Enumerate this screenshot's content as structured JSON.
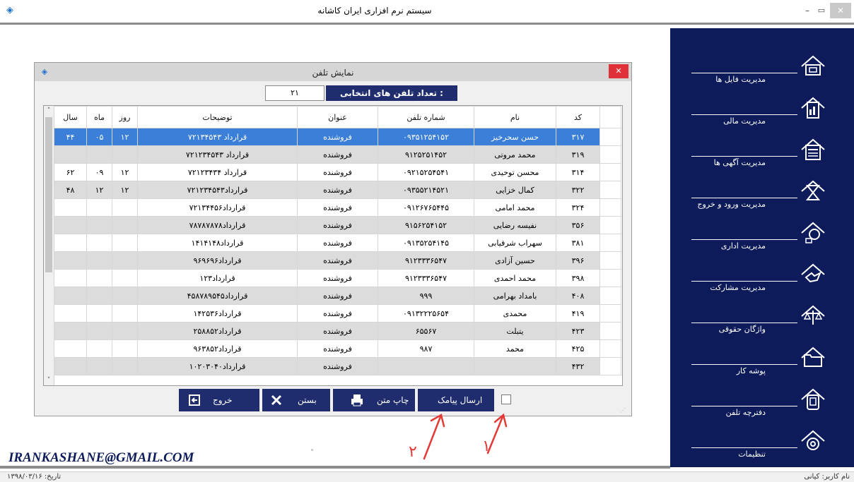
{
  "window": {
    "title": "سیستم نرم افزاری ایران کاشانه",
    "minimize": "–",
    "maximize": "▭",
    "close": "✕",
    "app_icon": "◈"
  },
  "sidebar": {
    "items": [
      {
        "label": "مدیریت فایل ها",
        "icon": "folder-icon"
      },
      {
        "label": "مدیریت مالی",
        "icon": "finance-document-icon"
      },
      {
        "label": "مدیریت آگهی ها",
        "icon": "news-icon"
      },
      {
        "label": "مدیریت ورود و خروج",
        "icon": "hourglass-icon"
      },
      {
        "label": "مدیریت اداری",
        "icon": "office-icon"
      },
      {
        "label": "مدیریت مشارکت",
        "icon": "handshake-icon"
      },
      {
        "label": "واژگان حقوقی",
        "icon": "scales-icon"
      },
      {
        "label": "پوشه کار",
        "icon": "open-folder-icon"
      },
      {
        "label": "دفترچه تلفن",
        "icon": "phone-icon"
      },
      {
        "label": "تنظیمات",
        "icon": "gear-icon"
      }
    ]
  },
  "dialog": {
    "title": "نمایش تلفن",
    "close": "✕",
    "count_label": "تعداد تلفن های انتخابی :",
    "count_value": "۲۱",
    "columns": [
      "سال",
      "ماه",
      "روز",
      "توضیحات",
      "عنوان",
      "شماره تلفن",
      "نام",
      "کد"
    ],
    "rows": [
      [
        "۴۴",
        "۰۵",
        "۱۲",
        "قرارداد ۷۲۱۳۴۵۴۳",
        "فروشنده",
        "۰۹۳۵۱۲۵۴۱۵۲",
        "حسن سحرخیز",
        "۳۱۷"
      ],
      [
        "",
        "",
        "",
        "قرارداد ۷۲۱۲۳۴۵۴۳",
        "فروشنده",
        "۹۱۲۵۲۵۱۴۵۲",
        "محمد مروتی",
        "۳۱۹"
      ],
      [
        "۶۲",
        "۰۹",
        "۱۲",
        "قرارداد ۷۲۱۲۳۴۳۴",
        "فروشنده",
        "۰۹۲۱۵۲۵۴۵۴۱",
        "محسن توحیدی",
        "۳۱۴"
      ],
      [
        "۴۸",
        "۱۲",
        "۱۲",
        "قرارداد۷۲۱۲۳۴۵۴۳",
        "فروشنده",
        "۰۹۳۵۵۲۱۴۵۲۱",
        "کمال خزایی",
        "۳۲۲"
      ],
      [
        "",
        "",
        "",
        "قرارداد۷۲۱۳۴۴۵۶",
        "فروشنده",
        "۰۹۱۲۶۷۶۵۴۴۵",
        "محمد امامی",
        "۳۲۴"
      ],
      [
        "",
        "",
        "",
        "قرارداد۷۸۷۸۷۸۷۸",
        "فروشنده",
        "۹۱۵۶۲۵۴۱۵۲",
        "نفیسه رضایی",
        "۳۵۶"
      ],
      [
        "",
        "",
        "",
        "قرارداد۱۴۱۴۱۴۸",
        "فروشنده",
        "۰۹۱۳۵۲۵۴۱۴۵",
        "سهراب شرفیابی",
        "۳۸۱"
      ],
      [
        "",
        "",
        "",
        "قرارداد۹۶۹۶۹۶",
        "فروشنده",
        "۹۱۲۳۳۳۶۵۴۷",
        "حسین آزادی",
        "۳۹۶"
      ],
      [
        "",
        "",
        "",
        "قرارداد۱۲۳",
        "فروشنده",
        "۹۱۲۳۳۳۶۵۴۷",
        "محمد احمدی",
        "۳۹۸"
      ],
      [
        "",
        "",
        "",
        "قرارداد۴۵۸۷۸۹۵۴۵",
        "فروشنده",
        "۹۹۹",
        "بامداد بهرامی",
        "۴۰۸"
      ],
      [
        "",
        "",
        "",
        "قرارداد۱۴۲۵۳۶",
        "فروشنده",
        "۰۹۱۳۲۲۲۵۶۵۴",
        "محمدی",
        "۴۱۹"
      ],
      [
        "",
        "",
        "",
        "قرارداد۲۵۸۸۵۲",
        "فروشنده",
        "۶۵۵۶۷",
        "یتبلت",
        "۴۲۳"
      ],
      [
        "",
        "",
        "",
        "قرارداد۹۶۳۸۵۲",
        "فروشنده",
        "۹۸۷",
        "محمد",
        "۴۲۵"
      ],
      [
        "",
        "",
        "",
        "قرارداد۱۰۲۰۳۰۴۰",
        "فروشنده",
        "",
        "",
        "۴۳۲"
      ]
    ],
    "row_indicator": "◂",
    "scroll_up": "˄",
    "scroll_down": "˅"
  },
  "buttons": {
    "exit": "خروج",
    "close": "بستن",
    "print": "چاپ متن",
    "send_sms": "ارسال پیامک"
  },
  "annotations": {
    "label_1": "۱",
    "label_2": "۲"
  },
  "footer": {
    "email": "IRANKASHANE@GMAIL.COM",
    "user": "نام کاربر: کیانی",
    "date": "تاریخ: ۱۳۹۸/۰۳/۱۶"
  },
  "colors": {
    "accent": "#1f2d6e",
    "sidebar_bg": "#0d1b5a",
    "selection": "#3c7fd9",
    "annotation": "#e53935"
  }
}
